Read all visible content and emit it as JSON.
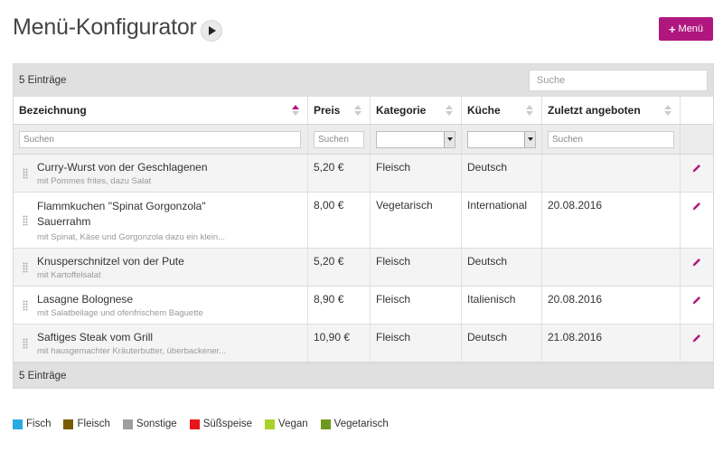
{
  "page": {
    "title": "Menü-Konfigurator",
    "new_button": "Menü"
  },
  "grid": {
    "count_label": "5 Einträge",
    "search_placeholder": "Suche",
    "columns": [
      {
        "label": "Bezeichnung",
        "sort": "asc"
      },
      {
        "label": "Preis",
        "sort": "none"
      },
      {
        "label": "Kategorie",
        "sort": "none"
      },
      {
        "label": "Küche",
        "sort": "none"
      },
      {
        "label": "Zuletzt angeboten",
        "sort": "none"
      },
      {
        "label": ""
      }
    ],
    "filter_placeholder": "Suchen",
    "rows": [
      {
        "name": "Curry-Wurst von der Geschlagenen",
        "desc": "mit Pommes frites, dazu Salat",
        "price": "5,20 €",
        "category": "Fleisch",
        "cuisine": "Deutsch",
        "last": ""
      },
      {
        "name": "Flammkuchen \"Spinat Gorgonzola\" Sauerrahm",
        "desc": "mit Spinat, Käse und Gorgonzola dazu ein klein...",
        "price": "8,00 €",
        "category": "Vegetarisch",
        "cuisine": "International",
        "last": "20.08.2016"
      },
      {
        "name": "Knusperschnitzel von der Pute",
        "desc": "mit Kartoffelsalat",
        "price": "5,20 €",
        "category": "Fleisch",
        "cuisine": "Deutsch",
        "last": ""
      },
      {
        "name": "Lasagne Bolognese",
        "desc": "mit Salatbeilage und ofenfrischem Baguette",
        "price": "8,90 €",
        "category": "Fleisch",
        "cuisine": "Italienisch",
        "last": "20.08.2016"
      },
      {
        "name": "Saftiges Steak vom Grill",
        "desc": "mit hausgemachter Kräuterbutter, überbackener...",
        "price": "10,90 €",
        "category": "Fleisch",
        "cuisine": "Deutsch",
        "last": "21.08.2016"
      }
    ]
  },
  "legend": [
    {
      "label": "Fisch",
      "color": "#29abe2"
    },
    {
      "label": "Fleisch",
      "color": "#7a5c00"
    },
    {
      "label": "Sonstige",
      "color": "#9e9e9e"
    },
    {
      "label": "Süßspeise",
      "color": "#e8141b"
    },
    {
      "label": "Vegan",
      "color": "#a8d12a"
    },
    {
      "label": "Vegetarisch",
      "color": "#6f9a1d"
    }
  ],
  "colors": {
    "accent": "#b0177e"
  }
}
